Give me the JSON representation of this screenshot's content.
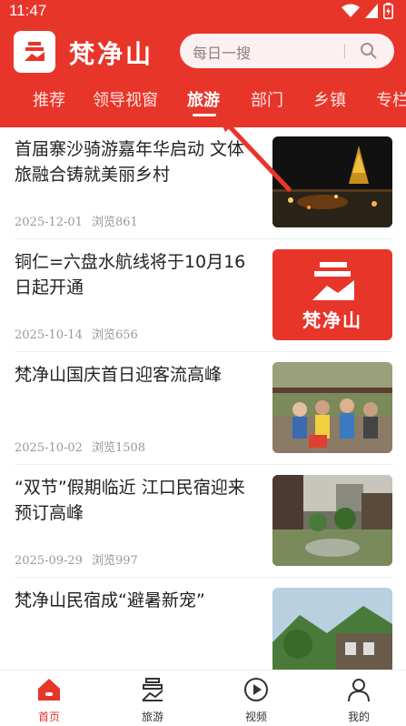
{
  "status_bar": {
    "time": "11:47"
  },
  "header": {
    "app_title": "梵净山",
    "logo_text": "梵净山",
    "search_placeholder": "每日一搜"
  },
  "tabs": [
    {
      "label": "推荐"
    },
    {
      "label": "领导视窗"
    },
    {
      "label": "旅游",
      "active": true
    },
    {
      "label": "部门"
    },
    {
      "label": "乡镇"
    },
    {
      "label": "专栏"
    }
  ],
  "articles": [
    {
      "title": "首届寨沙骑游嘉年华启动 文体旅融合铸就美丽乡村",
      "date": "2025-12-01",
      "views": "浏览861",
      "thumb": "night-festival-photo"
    },
    {
      "title": "铜仁=六盘水航线将于10月16日起开通",
      "date": "2025-10-14",
      "views": "浏览656",
      "thumb": "fanjingshan-logo-red"
    },
    {
      "title": "梵净山国庆首日迎客流高峰",
      "date": "2025-10-02",
      "views": "浏览1508",
      "thumb": "crowd-photo"
    },
    {
      "title": "“双节”假期临近 江口民宿迎来预订高峰",
      "date": "2025-09-29",
      "views": "浏览997",
      "thumb": "courtyard-photo"
    },
    {
      "title": "梵净山民宿成“避暑新宠”",
      "date": "",
      "views": "",
      "thumb": "guesthouse-photo"
    }
  ],
  "bottom_nav": [
    {
      "label": "首页",
      "icon": "home-icon",
      "active": true
    },
    {
      "label": "旅游",
      "icon": "travel-icon"
    },
    {
      "label": "视频",
      "icon": "play-icon"
    },
    {
      "label": "我的",
      "icon": "user-icon"
    }
  ],
  "colors": {
    "brand": "#e8352a",
    "text": "#222222",
    "meta": "#999999"
  }
}
